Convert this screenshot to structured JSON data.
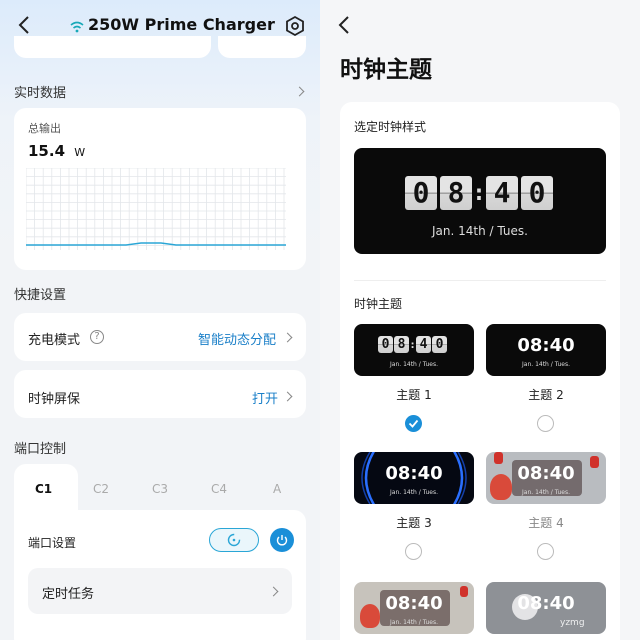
{
  "left": {
    "header": {
      "title": "250W Prime Charger"
    },
    "realtime": {
      "section_title": "实时数据",
      "output_label": "总输出",
      "output_value": "15.4",
      "output_unit": "W"
    },
    "quick": {
      "section_title": "快捷设置",
      "charge_mode_label": "充电模式",
      "charge_mode_value": "智能动态分配",
      "clock_saver_label": "时钟屏保",
      "clock_saver_value": "打开"
    },
    "ports": {
      "section_title": "端口控制",
      "tabs": [
        "C1",
        "C2",
        "C3",
        "C4",
        "A"
      ],
      "active_tab": "C1",
      "port_settings_label": "端口设置",
      "timer_label": "定时任务"
    }
  },
  "right": {
    "page_title": "时钟主题",
    "selected_style_label": "选定时钟样式",
    "preview": {
      "time": "08:40",
      "date": "Jan. 14th / Tues."
    },
    "themes_label": "时钟主题",
    "themes": [
      {
        "name": "主题 1",
        "time": "08:40",
        "date": "Jan. 14th / Tues.",
        "selected": true
      },
      {
        "name": "主题 2",
        "time": "08:40",
        "date": "Jan. 14th / Tues.",
        "selected": false
      },
      {
        "name": "主题 3",
        "time": "08:40",
        "date": "Jan. 14th / Tues.",
        "selected": false
      },
      {
        "name": "主题 4",
        "time": "08:40",
        "date": "Jan. 14th / Tues.",
        "selected": false
      },
      {
        "name": "",
        "time": "08:40",
        "date": "Jan. 14th / Tues.",
        "selected": false
      },
      {
        "name": "",
        "time": "08:40",
        "date": "",
        "selected": false
      }
    ],
    "watermark": "yzmg"
  },
  "colors": {
    "accent": "#1a8fd8",
    "chart_line": "#2aa6d6"
  }
}
